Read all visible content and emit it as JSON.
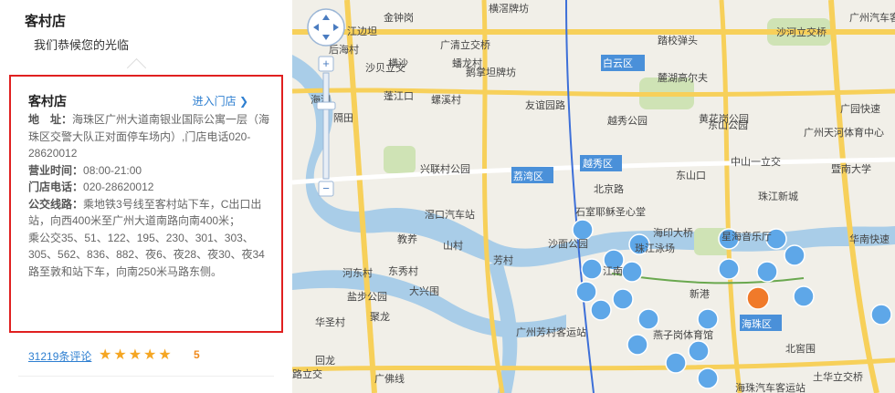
{
  "sidebar": {
    "title": "客村店",
    "subtitle": "我们恭候您的光临",
    "card": {
      "name": "客村店",
      "enter_link": "进入门店 ❯",
      "address_label": "地　址：",
      "address": "海珠区广州大道南银业国际公寓一层（海珠区交警大队正对面停车场内）,门店电话020-28620012",
      "hours_label": "营业时间：",
      "hours": "08:00-21:00",
      "phone_label": "门店电话：",
      "phone": "020-28620012",
      "transit_label": "公交线路：",
      "transit": "乘地铁3号线至客村站下车，C出口出站，向西400米至广州大道南路向南400米；",
      "bus": "乘公交35、51、122、195、230、301、303、305、562、836、882、夜6、夜28、夜30、夜34路至敦和站下车，向南250米马路东侧。"
    },
    "reviews": "31219条评论",
    "rating_stars": "★★★★★",
    "score": "5"
  },
  "map": {
    "labels": [
      "金钟岗",
      "江边坦",
      "后海村",
      "横沙",
      "蟠龙村",
      "沙贝立交",
      "广清立交桥",
      "横滘牌坊",
      "鹅掌坦牌坊",
      "白云区",
      "踏校弹头",
      "沙河立交桥",
      "广州汽车客运",
      "海湖",
      "隔田",
      "蓬江口",
      "螺溪村",
      "友谊园路",
      "麓湖高尔夫",
      "越秀公园",
      "广园快速",
      "东山公园",
      "黄花岗公园",
      "广州天河体育中心",
      "兴联村公园",
      "荔湾区",
      "越秀区",
      "北京路",
      "东山口",
      "中山一立交",
      "暨南大学",
      "珠江新城",
      "滘口汽车站",
      "石室耶稣圣心堂",
      "海印大桥",
      "教养",
      "山村",
      "芳村",
      "沙面公园",
      "珠江泳场",
      "星海音乐厅",
      "华南快速",
      "河东村",
      "东秀村",
      "大兴围",
      "江南",
      "新港",
      "盐步公园",
      "聚龙",
      "华圣村",
      "广州芳村客运站",
      "燕子岗体育馆",
      "海珠区",
      "北窖围",
      "广佛线",
      "回龙",
      "路立交",
      "海珠汽车客运站",
      "土华立交桥"
    ],
    "marker_label": "海珠区"
  }
}
